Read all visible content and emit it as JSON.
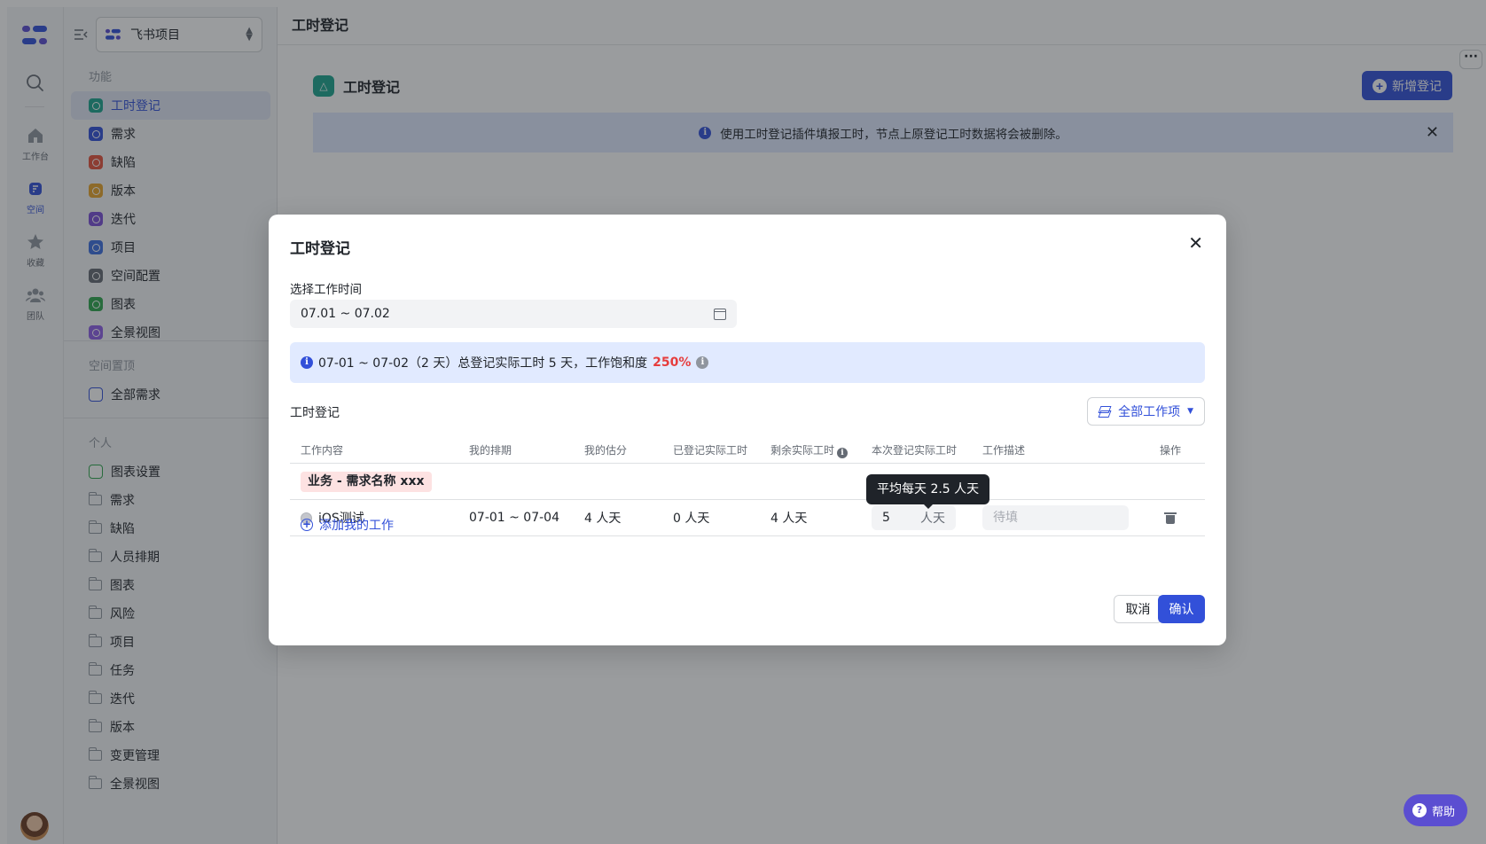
{
  "rail": {
    "items": [
      {
        "label": "工作台",
        "icon": "home-icon"
      },
      {
        "label": "空间",
        "icon": "space-icon"
      },
      {
        "label": "收藏",
        "icon": "star-icon"
      },
      {
        "label": "团队",
        "icon": "team-icon"
      }
    ]
  },
  "sidebar": {
    "project_name": "飞书项目",
    "section_features": "功能",
    "features": [
      {
        "label": "工时登记",
        "color": "#1ca58e"
      },
      {
        "label": "需求",
        "color": "#3250d9"
      },
      {
        "label": "缺陷",
        "color": "#e5533d"
      },
      {
        "label": "版本",
        "color": "#e8a52b"
      },
      {
        "label": "迭代",
        "color": "#7a4fd8"
      },
      {
        "label": "项目",
        "color": "#3d6fe0"
      },
      {
        "label": "空间配置",
        "color": "#646a73"
      },
      {
        "label": "图表",
        "color": "#2fa64e"
      },
      {
        "label": "全景视图",
        "color": "#8f5fe8"
      }
    ],
    "section_pinned": "空间置顶",
    "pinned": [
      "全部需求"
    ],
    "section_personal": "个人",
    "personal": [
      "图表设置",
      "需求",
      "缺陷",
      "人员排期",
      "图表",
      "风险",
      "项目",
      "任务",
      "迭代",
      "版本",
      "变更管理",
      "全景视图"
    ]
  },
  "main": {
    "topbar_title": "工时登记",
    "page_title": "工时登记",
    "new_button": "新增登记",
    "notice": "使用工时登记插件填报工时，节点上原登记工时数据将会被删除。",
    "help": "帮助"
  },
  "modal": {
    "title": "工时登记",
    "date_label": "选择工作时间",
    "date_value": "07.01 ~ 07.02",
    "summary_text": "07-01 ~ 07-02（2 天）总登记实际工时 5 天，工作饱和度",
    "summary_pct": "250%",
    "section_title": "工时登记",
    "filter_label": "全部工作项",
    "columns": [
      "工作内容",
      "我的排期",
      "我的估分",
      "已登记实际工时",
      "剩余实际工时",
      "本次登记实际工时",
      "工作描述",
      "操作"
    ],
    "group_tag": "业务 - 需求名称 xxx",
    "row": {
      "name": "iOS测试",
      "schedule": "07-01 ~ 07-04",
      "estimate": "4 人天",
      "logged": "0 人天",
      "remaining": "4 人天",
      "current_value": "5",
      "current_unit": "人天",
      "desc_placeholder": "待填"
    },
    "tooltip": "平均每天 2.5 人天",
    "add_work": "添加我的工作",
    "cancel": "取消",
    "confirm": "确认"
  }
}
